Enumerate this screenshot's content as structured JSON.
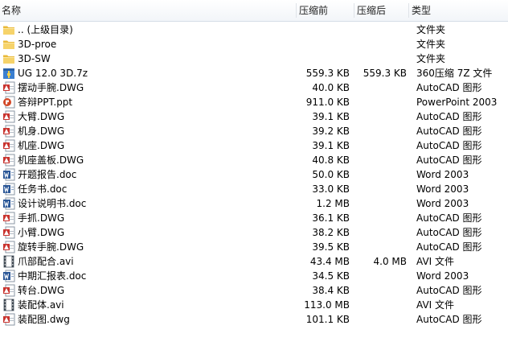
{
  "columns": {
    "name": "名称",
    "before": "压缩前",
    "after": "压缩后",
    "type": "类型"
  },
  "files": [
    {
      "icon": "folder-icon",
      "name": ".. (上级目录)",
      "before": "",
      "after": "",
      "type": "文件夹"
    },
    {
      "icon": "folder-icon",
      "name": "3D-proe",
      "before": "",
      "after": "",
      "type": "文件夹"
    },
    {
      "icon": "folder-icon",
      "name": "3D-SW",
      "before": "",
      "after": "",
      "type": "文件夹"
    },
    {
      "icon": "archive-icon",
      "name": "UG 12.0 3D.7z",
      "before": "559.3 KB",
      "after": "559.3 KB",
      "type": "360压缩 7Z 文件"
    },
    {
      "icon": "dwg-icon",
      "name": "摆动手腕.DWG",
      "before": "40.0 KB",
      "after": "",
      "type": "AutoCAD 图形"
    },
    {
      "icon": "ppt-icon",
      "name": "答辩PPT.ppt",
      "before": "911.0 KB",
      "after": "",
      "type": "PowerPoint 2003"
    },
    {
      "icon": "dwg-icon",
      "name": "大臂.DWG",
      "before": "39.1 KB",
      "after": "",
      "type": "AutoCAD 图形"
    },
    {
      "icon": "dwg-icon",
      "name": "机身.DWG",
      "before": "39.2 KB",
      "after": "",
      "type": "AutoCAD 图形"
    },
    {
      "icon": "dwg-icon",
      "name": "机座.DWG",
      "before": "39.1 KB",
      "after": "",
      "type": "AutoCAD 图形"
    },
    {
      "icon": "dwg-icon",
      "name": "机座盖板.DWG",
      "before": "40.8 KB",
      "after": "",
      "type": "AutoCAD 图形"
    },
    {
      "icon": "word-icon",
      "name": "开题报告.doc",
      "before": "50.0 KB",
      "after": "",
      "type": "Word 2003"
    },
    {
      "icon": "word-icon",
      "name": "任务书.doc",
      "before": "33.0 KB",
      "after": "",
      "type": "Word 2003"
    },
    {
      "icon": "word-icon",
      "name": "设计说明书.doc",
      "before": "1.2 MB",
      "after": "",
      "type": "Word 2003"
    },
    {
      "icon": "dwg-icon",
      "name": "手抓.DWG",
      "before": "36.1 KB",
      "after": "",
      "type": "AutoCAD 图形"
    },
    {
      "icon": "dwg-icon",
      "name": "小臂.DWG",
      "before": "38.2 KB",
      "after": "",
      "type": "AutoCAD 图形"
    },
    {
      "icon": "dwg-icon",
      "name": "旋转手腕.DWG",
      "before": "39.5 KB",
      "after": "",
      "type": "AutoCAD 图形"
    },
    {
      "icon": "video-icon",
      "name": "爪部配合.avi",
      "before": "43.4 MB",
      "after": "4.0 MB",
      "type": "AVI 文件"
    },
    {
      "icon": "word-icon",
      "name": "中期汇报表.doc",
      "before": "34.5 KB",
      "after": "",
      "type": "Word 2003"
    },
    {
      "icon": "dwg-icon",
      "name": "转台.DWG",
      "before": "38.4 KB",
      "after": "",
      "type": "AutoCAD 图形"
    },
    {
      "icon": "video-icon",
      "name": "装配体.avi",
      "before": "113.0 MB",
      "after": "",
      "type": "AVI 文件"
    },
    {
      "icon": "dwg-icon",
      "name": "装配图.dwg",
      "before": "101.1 KB",
      "after": "",
      "type": "AutoCAD 图形"
    }
  ]
}
